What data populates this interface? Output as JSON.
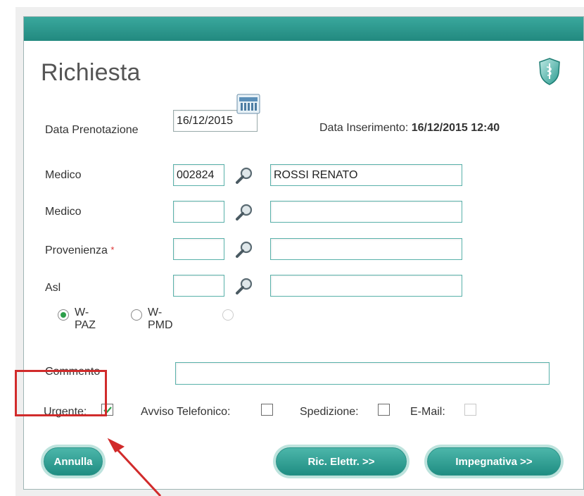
{
  "form": {
    "title": "Richiesta",
    "data_prenotazione_label": "Data Prenotazione",
    "data_prenotazione_value": "16/12/2015",
    "data_inserimento_label": "Data Inserimento:",
    "data_inserimento_value": "16/12/2015 12:40",
    "rows": [
      {
        "label": "Medico",
        "code": "002824",
        "name": "ROSSI RENATO",
        "required": false
      },
      {
        "label": "Medico",
        "code": "",
        "name": "",
        "required": false
      },
      {
        "label": "Provenienza",
        "code": "",
        "name": "",
        "required": true
      },
      {
        "label": "Asl",
        "code": "",
        "name": "",
        "required": false
      }
    ],
    "required_marker": "*",
    "radios": [
      {
        "label": "W-PAZ",
        "checked": true
      },
      {
        "label": "W-PMD",
        "checked": false
      },
      {
        "label": "",
        "checked": false,
        "disabled": true
      }
    ],
    "commento_label": "Commento",
    "commento_value": "",
    "checkboxes": [
      {
        "label": "Urgente:",
        "checked": true
      },
      {
        "label": "Avviso Telefonico:",
        "checked": false
      },
      {
        "label": "Spedizione:",
        "checked": false
      },
      {
        "label": "E-Mail:",
        "checked": false,
        "disabled": true
      }
    ],
    "buttons": {
      "annulla": "Annulla",
      "ric_elettr": "Ric. Elettr. >>",
      "impegnativa": "Impegnativa >>"
    }
  },
  "colors": {
    "header": "#22897f",
    "accent": "#59b1aa",
    "highlight": "#d12b2b"
  },
  "icons": {
    "calendar": "calendar-icon",
    "search": "magnifier-icon",
    "shield": "shield-logo-icon"
  }
}
